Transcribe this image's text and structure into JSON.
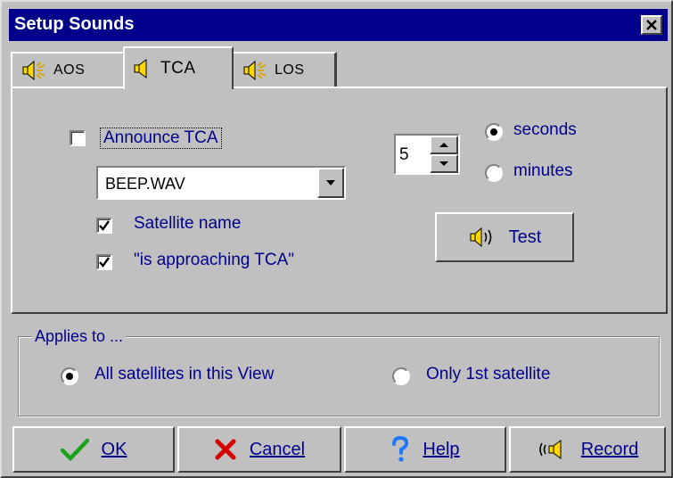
{
  "window": {
    "title": "Setup Sounds"
  },
  "tabs": [
    {
      "label": "AOS",
      "active": false
    },
    {
      "label": "TCA",
      "active": true
    },
    {
      "label": "LOS",
      "active": false
    }
  ],
  "announce": {
    "label": "Announce TCA",
    "checked": false
  },
  "sound_file": {
    "value": "BEEP.WAV"
  },
  "satellite_name": {
    "label": "Satellite name",
    "checked": true
  },
  "approaching": {
    "label": "\"is approaching TCA\"",
    "checked": true
  },
  "time_value": {
    "value": "5"
  },
  "units": {
    "seconds": {
      "label": "seconds",
      "selected": true
    },
    "minutes": {
      "label": "minutes",
      "selected": false
    }
  },
  "test_button": {
    "label": "Test"
  },
  "applies_to": {
    "legend": "Applies to ...",
    "options": [
      {
        "label": "All satellites in this View",
        "selected": true
      },
      {
        "label": "Only 1st satellite",
        "selected": false
      }
    ]
  },
  "buttons": {
    "ok": "OK",
    "cancel": "Cancel",
    "help": "Help",
    "record": "Record"
  },
  "colors": {
    "title_bar": "#00008b",
    "label_text": "#00008b",
    "face": "#c0c0c0",
    "ok_check": "#1aa31a",
    "cancel_x": "#d40000",
    "help_question": "#1e78ff",
    "speaker_yellow": "#ffd700"
  }
}
